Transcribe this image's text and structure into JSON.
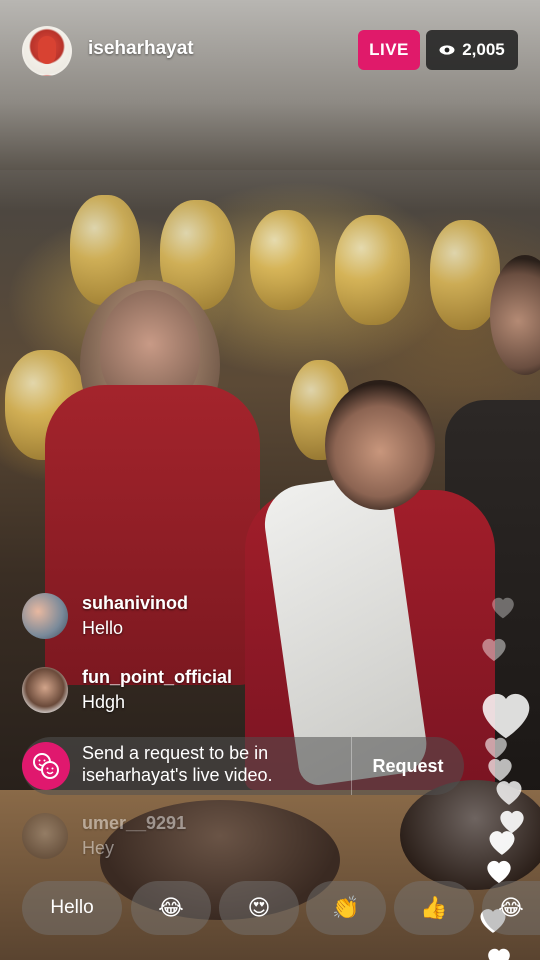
{
  "header": {
    "username": "iseharhayat",
    "live_label": "LIVE",
    "viewer_count": "2,005"
  },
  "comments": [
    {
      "user": "suhanivinod",
      "text": "Hello"
    },
    {
      "user": "fun_point_official",
      "text": "Hdgh"
    },
    {
      "user": "umer__9291",
      "text": "Hey"
    }
  ],
  "request": {
    "line1": "Send a request to be in",
    "line2": "iseharhayat's live video.",
    "button_label": "Request"
  },
  "quick_reactions": {
    "text_reply": "Hello",
    "emojis": [
      "😂",
      "😍",
      "👏",
      "👍",
      "😂"
    ]
  },
  "colors": {
    "live": "#e01a6a",
    "request_icon": "#e0186e",
    "heart": "#ffffff"
  }
}
